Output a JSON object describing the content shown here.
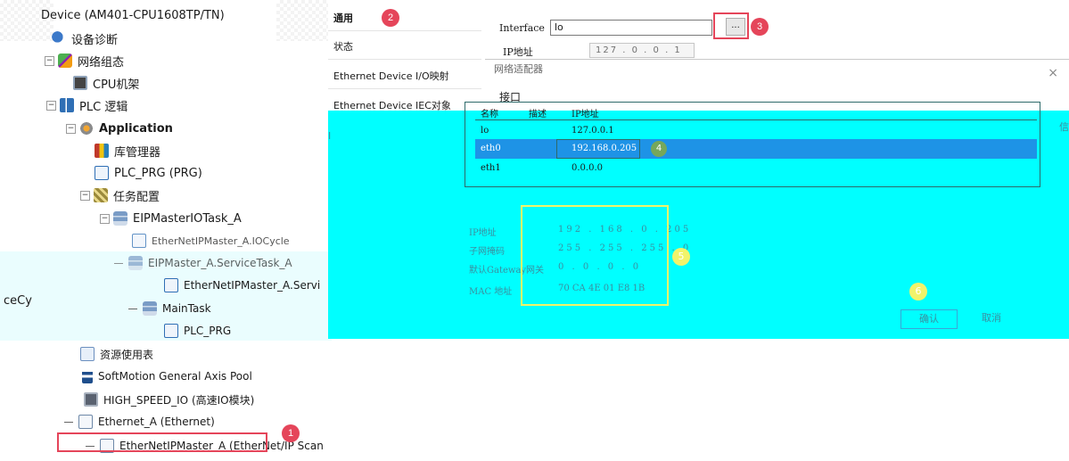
{
  "tree": {
    "device": "Device (AM401-CPU1608TP/TN)",
    "items": [
      {
        "label": "设备诊断"
      },
      {
        "label": "网络组态"
      },
      {
        "label": "CPU机架"
      },
      {
        "label": "PLC 逻辑"
      },
      {
        "label": "Application"
      },
      {
        "label": "库管理器"
      },
      {
        "label": "PLC_PRG (PRG)"
      },
      {
        "label": "任务配置"
      },
      {
        "label": "EIPMasterIOTask_A"
      },
      {
        "label": "EtherNetIPMaster_A.IOCycle"
      },
      {
        "label": "EIPMaster_A.ServiceTask_A"
      },
      {
        "label": "EtherNetIPMaster_A.Servi"
      },
      {
        "label": "MainTask"
      },
      {
        "label": "PLC_PRG"
      },
      {
        "label": "资源使用表"
      },
      {
        "label": "SoftMotion General Axis Pool"
      },
      {
        "label": "HIGH_SPEED_IO (高速IO模块)"
      },
      {
        "label": "Ethernet_A (Ethernet)"
      },
      {
        "label": "EtherNetIPMaster_A (EtherNet/IP Scan"
      }
    ],
    "cut_text": "ceCy",
    "expand_plus": "+",
    "expand_minus": "−"
  },
  "badges": {
    "b1": "1",
    "b2": "2",
    "b3": "3",
    "b4": "4",
    "b5": "5",
    "b6": "6"
  },
  "settings": {
    "tabs": [
      "通用",
      "状态",
      "Ethernet Device I/O映射",
      "Ethernet Device IEC对象"
    ],
    "interface_label": "Interface",
    "interface_value": "lo",
    "browse_label": "...",
    "ip_label": "IP地址",
    "ip_value": "127 . 0 . 0 . 1",
    "edge_left": "I",
    "edge_right": "信"
  },
  "dialog": {
    "title": "网络适配器",
    "close": "×",
    "tab": "接口",
    "columns": [
      "名称",
      "描述",
      "IP地址"
    ],
    "rows": [
      {
        "name": "lo",
        "desc": "",
        "ip": "127.0.0.1"
      },
      {
        "name": "eth0",
        "desc": "",
        "ip": "192.168.0.205"
      },
      {
        "name": "eth1",
        "desc": "",
        "ip": "0.0.0.0"
      }
    ],
    "props": [
      {
        "label": "IP地址",
        "value": "192 . 168 . 0 . 205"
      },
      {
        "label": "子网掩码",
        "value": "255 . 255 . 255 . 0"
      },
      {
        "label": "默认Gateway网关",
        "value": "0 . 0 . 0 . 0"
      },
      {
        "label": "MAC 地址",
        "value": "70 CA 4E 01 E8 1B"
      }
    ],
    "ok": "确认",
    "cancel": "取消"
  },
  "colors": {
    "accent_red": "#e5455a",
    "highlight_yellow": "#f1f36a",
    "selection_blue": "#1e93e6",
    "dialog_cyan": "#00ffff"
  }
}
